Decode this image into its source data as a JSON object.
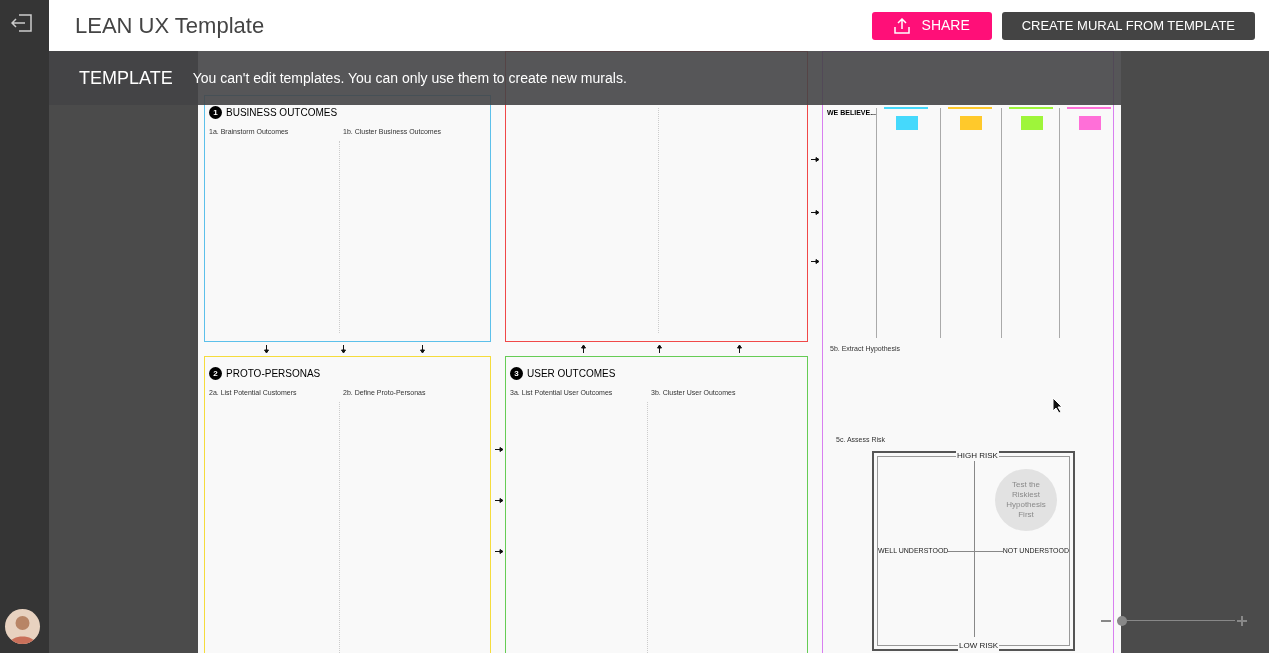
{
  "app": {
    "title": "LEAN UX Template"
  },
  "toolbar": {
    "buttons": [
      {
        "label": "SHARE",
        "kind": "share"
      },
      {
        "label": "CREATE MURAL FROM TEMPLATE",
        "kind": "create"
      }
    ]
  },
  "banner": {
    "label": "TEMPLATE",
    "message": "You can't edit templates. You can only use them to create new murals."
  },
  "board": {
    "sections": [
      {
        "kind": "plain",
        "number": "1",
        "title": "BUSINESS OUTCOMES",
        "color": "#5cc0ea",
        "subs": [
          "1a. Brainstorm Outcomes",
          "1b. Cluster Business Outcomes"
        ]
      },
      {
        "kind": "plain",
        "number": "2",
        "title": "PROTO-PERSONAS",
        "color": "#f5dc3c",
        "subs": [
          "2a. List Potential Customers",
          "2b. Define Proto-Personas"
        ]
      },
      {
        "kind": "covered",
        "color": "#f04848"
      },
      {
        "kind": "plain",
        "number": "3",
        "title": "USER OUTCOMES",
        "color": "#66cc55",
        "subs": [
          "3a. List Potential User Outcomes",
          "3b. Cluster User Outcomes"
        ]
      },
      {
        "kind": "hypothesis",
        "color": "#d87ff0",
        "subs": [
          "5b. Extract Hypothesis",
          "5c. Assess Risk"
        ],
        "row_label": "WE BELIEVE...",
        "notes": [
          {
            "color": "#45d9fc"
          },
          {
            "color": "#ffc92b"
          },
          {
            "color": "#9ef53a"
          },
          {
            "color": "#ff6fd8"
          }
        ],
        "matrix": {
          "top": "HIGH RISK",
          "left": "WELL UNDERSTOOD",
          "right": "NOT UNDERSTOOD",
          "bottom": "LOW RISK",
          "badge": "Test the Riskiest Hypothesis First"
        }
      }
    ]
  },
  "zoom": {
    "level": 0
  }
}
